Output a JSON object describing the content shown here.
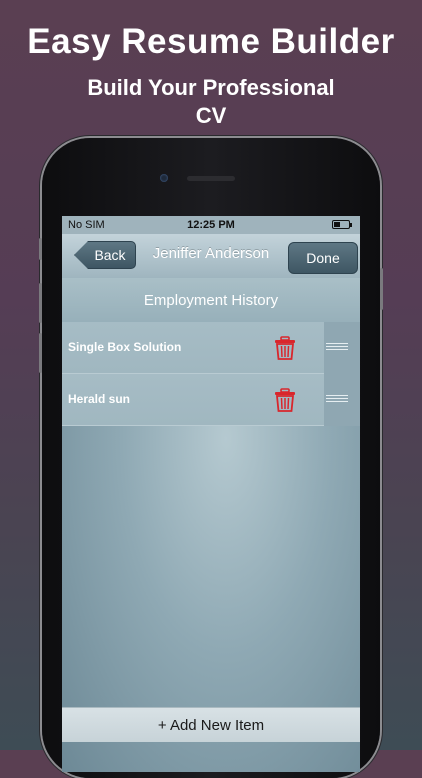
{
  "promo": {
    "title": "Easy Resume Builder",
    "subtitle": "Build Your Professional CV"
  },
  "status_bar": {
    "carrier": "No SIM",
    "time": "12:25 PM",
    "battery_level": 0.4
  },
  "navbar": {
    "back_label": "Back",
    "title": "Jeniffer Anderson",
    "done_label": "Done"
  },
  "section": {
    "title": "Employment History"
  },
  "items": [
    {
      "label": "Single Box Solution",
      "delete_icon": "trash-icon",
      "reorder_icon": "reorder-grip-icon"
    },
    {
      "label": "Herald sun",
      "delete_icon": "trash-icon",
      "reorder_icon": "reorder-grip-icon"
    }
  ],
  "footer": {
    "add_label": "+ Add New Item"
  },
  "colors": {
    "delete_red": "#d9262c",
    "nav_button": "#4e6673"
  }
}
